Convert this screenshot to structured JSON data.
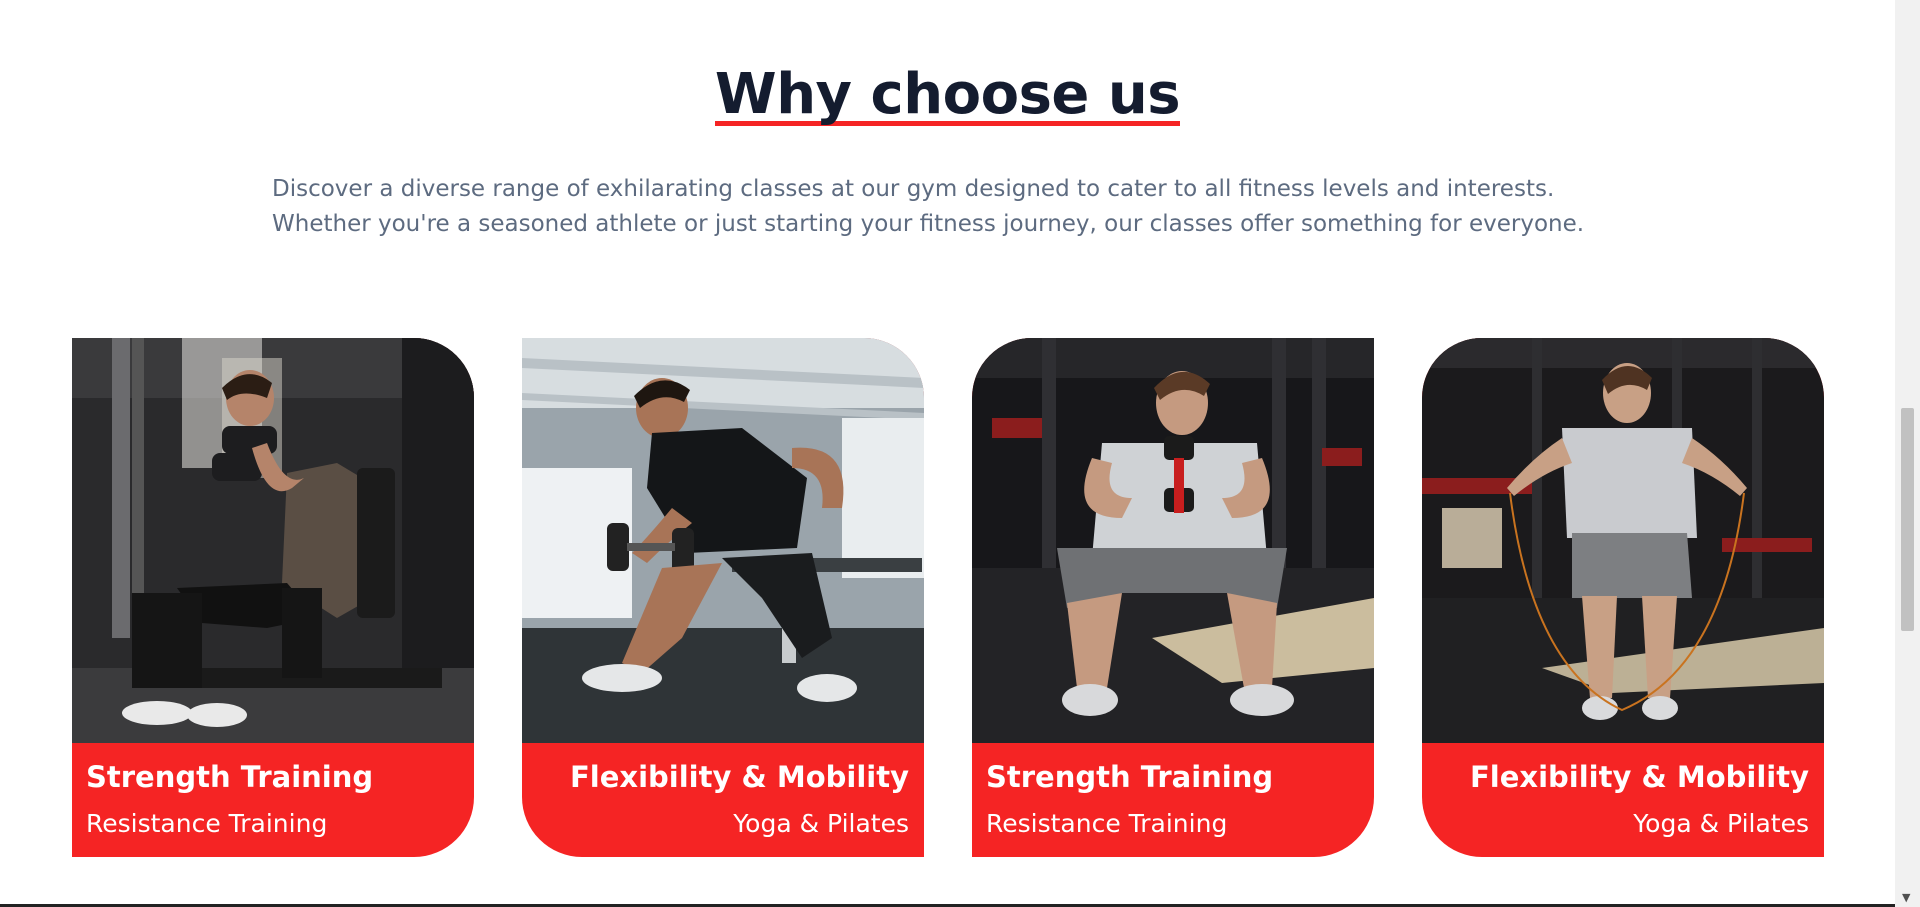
{
  "section": {
    "title": "Why choose us",
    "intro_lines": [
      "Discover a diverse range of exhilarating classes at our gym designed to cater to all fitness levels and interests.",
      "Whether you're a seasoned athlete or just starting your fitness journey, our classes offer something for everyone."
    ]
  },
  "cards": [
    {
      "title": "Strength Training",
      "subtitle": "Resistance Training",
      "image": "man-dumbbell-curl-seated-photo"
    },
    {
      "title": "Flexibility & Mobility",
      "subtitle": "Yoga & Pilates",
      "image": "man-dumbbell-row-bench-photo"
    },
    {
      "title": "Strength Training",
      "subtitle": "Resistance Training",
      "image": "man-goblet-squat-photo"
    },
    {
      "title": "Flexibility & Mobility",
      "subtitle": "Yoga & Pilates",
      "image": "man-jump-rope-photo"
    }
  ],
  "colors": {
    "accent": "#f52424",
    "heading": "#141c2f",
    "body_text": "#5d6b80"
  },
  "scrollbar": {
    "down_icon": "scroll-down-arrow-icon"
  }
}
